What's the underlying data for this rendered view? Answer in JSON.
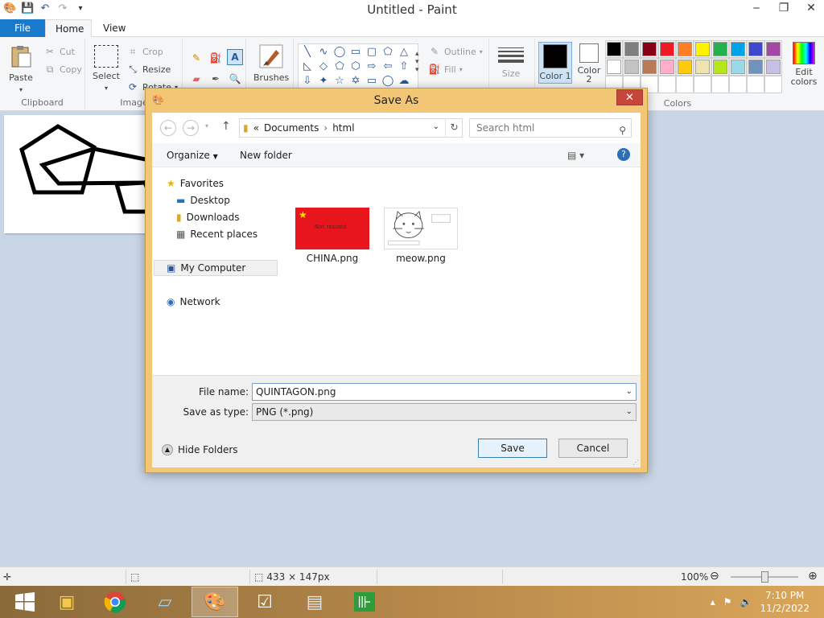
{
  "window": {
    "title": "Untitled - Paint",
    "controls": [
      "‒",
      "❐",
      "✕"
    ]
  },
  "ribbon": {
    "tabs": [
      "File",
      "Home",
      "View"
    ],
    "clipboard": {
      "paste": "Paste",
      "cut": "Cut",
      "copy": "Copy",
      "label": "Clipboard"
    },
    "image": {
      "select": "Select",
      "crop": "Crop",
      "resize": "Resize",
      "rotate": "Rotate",
      "label": "Image"
    },
    "tools": {
      "brushes": "Brushes"
    },
    "shapes": {
      "outline": "Outline",
      "fill": "Fill"
    },
    "size": "Size",
    "color1": "Color 1",
    "color2": "Color 2",
    "colors_label": "Colors",
    "edit_colors": "Edit colors",
    "palette_row1": [
      "#000000",
      "#7f7f7f",
      "#880015",
      "#ed1c24",
      "#ff7f27",
      "#fff200",
      "#22b14c",
      "#00a2e8",
      "#3f48cc",
      "#a349a4"
    ],
    "palette_row2": [
      "#ffffff",
      "#c3c3c3",
      "#b97a57",
      "#ffaec9",
      "#ffc90e",
      "#efe4b0",
      "#b5e61d",
      "#99d9ea",
      "#7092be",
      "#c8bfe7"
    ]
  },
  "dialog": {
    "title": "Save As",
    "breadcrumb": {
      "prefix": "«",
      "parent": "Documents",
      "sep": "›",
      "current": "html"
    },
    "search_placeholder": "Search html",
    "organize": "Organize",
    "new_folder": "New folder",
    "nav": {
      "favorites": "Favorites",
      "desktop": "Desktop",
      "downloads": "Downloads",
      "recent": "Recent places",
      "computer": "My Computer",
      "network": "Network"
    },
    "files": [
      {
        "name": "CHINA.png",
        "thumb_text": "Not resized"
      },
      {
        "name": "meow.png"
      }
    ],
    "file_name_label": "File name:",
    "file_name_value": "QUINTAGON.png",
    "type_label": "Save as type:",
    "type_value": "PNG (*.png)",
    "hide_folders": "Hide Folders",
    "save": "Save",
    "cancel": "Cancel"
  },
  "status": {
    "dimensions": "433 × 147px",
    "zoom": "100%"
  },
  "taskbar": {
    "time": "7:10 PM",
    "date": "11/2/2022"
  }
}
